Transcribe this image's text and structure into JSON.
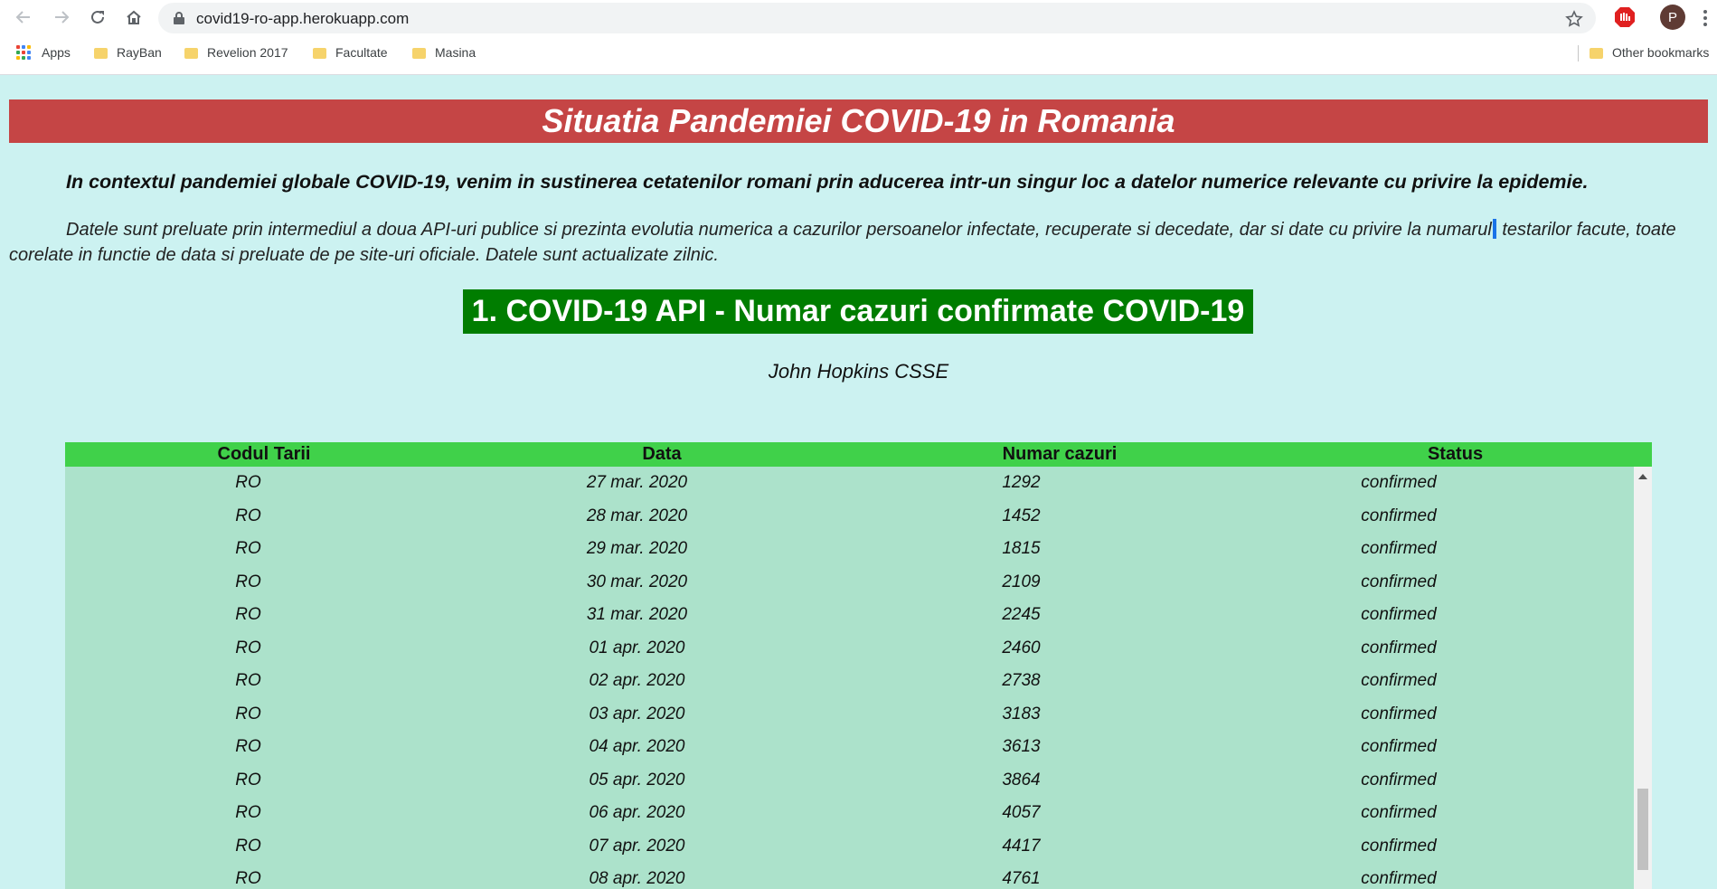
{
  "browser": {
    "url": "covid19-ro-app.herokuapp.com",
    "profile_initial": "P",
    "bookmarks": [
      {
        "label": "Apps"
      },
      {
        "label": "RayBan"
      },
      {
        "label": "Revelion 2017"
      },
      {
        "label": "Facultate"
      },
      {
        "label": "Masina"
      }
    ],
    "other_bookmarks": "Other bookmarks"
  },
  "page": {
    "title": "Situatia Pandemiei COVID-19 in Romania",
    "intro": "In contextul pandemiei globale COVID-19, venim in sustinerea cetatenilor romani prin aducerea intr-un singur loc a datelor numerice relevante cu privire la epidemie.",
    "desc_part1": "Datele sunt preluate prin intermediul a doua API-uri publice si prezinta evolutia numerica a cazurilor persoanelor infectate, recuperate si decedate, dar si date cu privire la numarul",
    "desc_part2": "testarilor facute, toate corelate in functie de data si preluate de pe site-uri oficiale. Datele sunt actualizate zilnic.",
    "section_title": "1. COVID-19 API - Numar cazuri confirmate COVID-19",
    "source": "John Hopkins CSSE"
  },
  "table": {
    "headers": [
      "Codul Tarii",
      "Data",
      "Numar cazuri",
      "Status"
    ],
    "rows": [
      [
        "RO",
        "27 mar. 2020",
        "1292",
        "confirmed"
      ],
      [
        "RO",
        "28 mar. 2020",
        "1452",
        "confirmed"
      ],
      [
        "RO",
        "29 mar. 2020",
        "1815",
        "confirmed"
      ],
      [
        "RO",
        "30 mar. 2020",
        "2109",
        "confirmed"
      ],
      [
        "RO",
        "31 mar. 2020",
        "2245",
        "confirmed"
      ],
      [
        "RO",
        "01 apr. 2020",
        "2460",
        "confirmed"
      ],
      [
        "RO",
        "02 apr. 2020",
        "2738",
        "confirmed"
      ],
      [
        "RO",
        "03 apr. 2020",
        "3183",
        "confirmed"
      ],
      [
        "RO",
        "04 apr. 2020",
        "3613",
        "confirmed"
      ],
      [
        "RO",
        "05 apr. 2020",
        "3864",
        "confirmed"
      ],
      [
        "RO",
        "06 apr. 2020",
        "4057",
        "confirmed"
      ],
      [
        "RO",
        "07 apr. 2020",
        "4417",
        "confirmed"
      ],
      [
        "RO",
        "08 apr. 2020",
        "4761",
        "confirmed"
      ]
    ]
  },
  "colors": {
    "page_bg": "#ccf2f1",
    "banner": "#c54545",
    "section": "#007d00",
    "table_header": "#40d14a",
    "table_body": "#ace2cb"
  }
}
